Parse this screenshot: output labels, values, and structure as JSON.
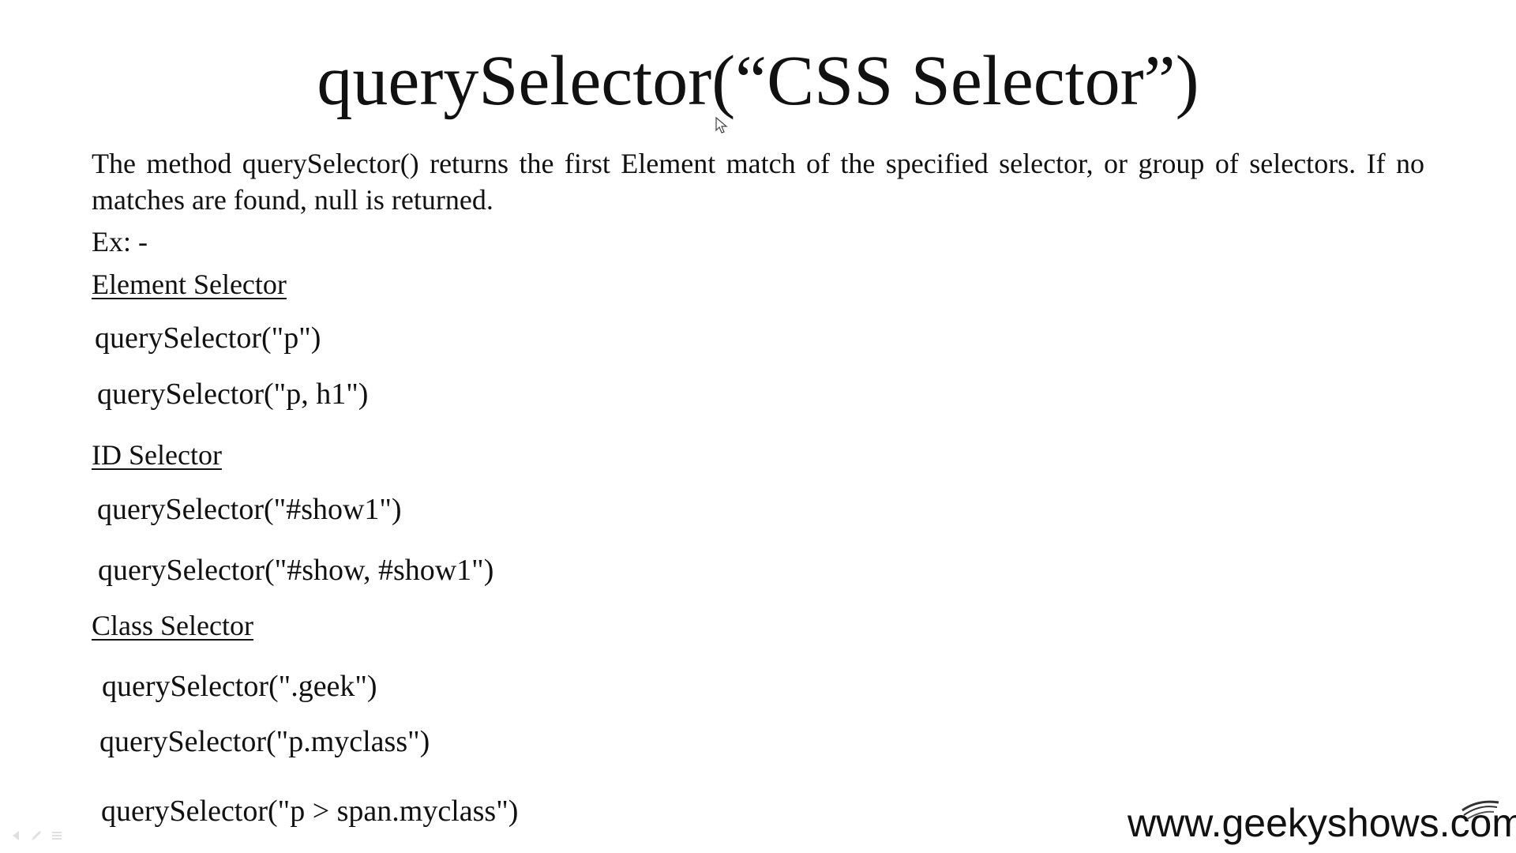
{
  "slide": {
    "title": "querySelector(“CSS Selector”)",
    "description": "The method querySelector() returns the first Element match of the specified selector, or group of selectors.  If no matches are found, null is returned.",
    "example_label": "Ex: -",
    "sections": [
      {
        "heading": "Element Selector",
        "examples": [
          "querySelector(\"p\")",
          "querySelector(\"p, h1\")"
        ]
      },
      {
        "heading": "ID Selector",
        "examples": [
          "querySelector(\"#show1\")",
          "querySelector(\"#show, #show1\")"
        ]
      },
      {
        "heading": "Class Selector",
        "examples": [
          "querySelector(\".geek\")",
          "querySelector(\"p.myclass\")",
          "querySelector(\"p > span.myclass\")"
        ]
      }
    ]
  },
  "watermark": {
    "text": "www.geekyshows.com"
  },
  "icons": {
    "cursor": "mouse-pointer-icon",
    "logo": "swoosh-logo-icon",
    "navigation": [
      "previous-slide-icon",
      "pen-tool-icon",
      "slide-menu-icon"
    ]
  }
}
